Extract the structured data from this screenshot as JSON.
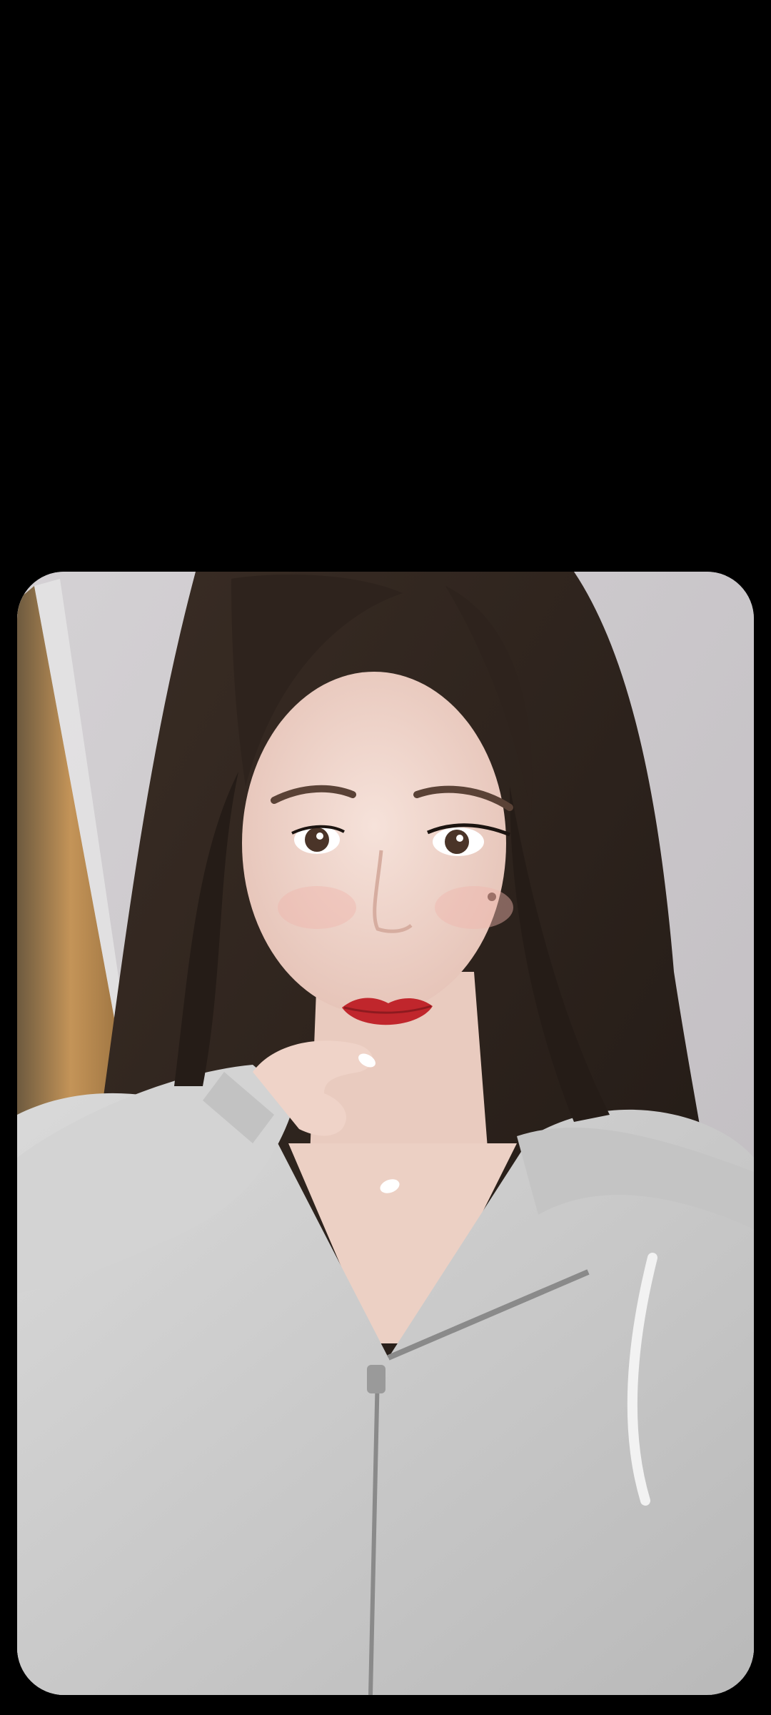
{
  "viewer": {
    "background_color": "#000000",
    "photo": {
      "subject": "selfie-portrait",
      "palette": {
        "wall": "#c9c6c8",
        "door_frame": "#b8894f",
        "hair": "#2b211c",
        "skin": "#f3d9cf",
        "lips": "#c0262c",
        "hoodie": "#cfcfcf",
        "nails": "#ffffff"
      }
    }
  }
}
